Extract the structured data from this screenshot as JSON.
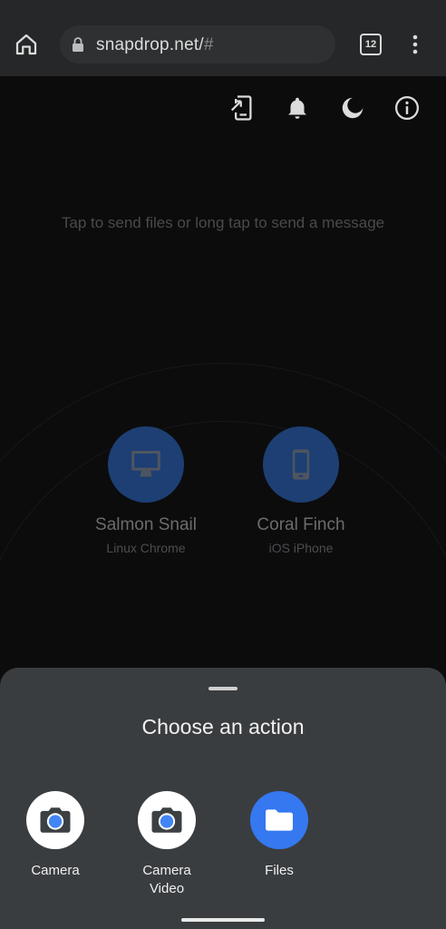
{
  "browser": {
    "url_domain": "snapdrop.net/",
    "url_hash": "#",
    "tab_count": "12"
  },
  "app": {
    "hint": "Tap to send files or long tap to send a message",
    "header_icons": [
      "install-icon",
      "bell-icon",
      "moon-icon",
      "info-icon"
    ],
    "peers": [
      {
        "name": "Salmon Snail",
        "device": "Linux Chrome",
        "icon": "desktop-icon"
      },
      {
        "name": "Coral Finch",
        "device": "iOS iPhone",
        "icon": "phone-icon"
      }
    ]
  },
  "sheet": {
    "title": "Choose an action",
    "options": [
      {
        "label": "Camera",
        "icon": "camera-icon"
      },
      {
        "label": "Camera\nVideo",
        "icon": "camera-icon"
      },
      {
        "label": "Files",
        "icon": "folder-icon"
      }
    ]
  },
  "colors": {
    "accent": "#1d3f73",
    "files_icon_bg": "#3578f0",
    "sheet_bg": "#3a3d40"
  }
}
